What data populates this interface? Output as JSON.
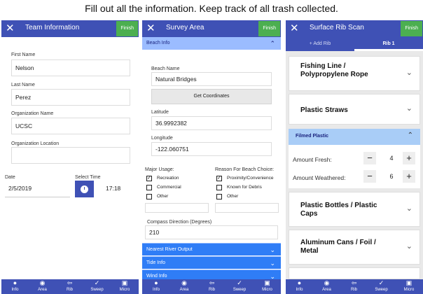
{
  "caption": "Fill out all the information. Keep track of all trash collected.",
  "finish_label": "Finish",
  "close_glyph": "✕",
  "team_info": {
    "title": "Team Information",
    "first_name": {
      "label": "First Name",
      "value": "Nelson"
    },
    "last_name": {
      "label": "Last Name",
      "value": "Perez"
    },
    "org_name": {
      "label": "Organization Name",
      "value": "UCSC"
    },
    "org_location": {
      "label": "Organization Location",
      "value": ""
    },
    "date": {
      "label": "Date",
      "value": "2/5/2019"
    },
    "time": {
      "label": "Select Time",
      "value": "17:18"
    }
  },
  "survey_area": {
    "title": "Survey Area",
    "section": "Beach Info",
    "beach_name": {
      "label": "Beach Name",
      "value": "Natural Bridges"
    },
    "get_coordinates": "Get Coordinates",
    "latitude": {
      "label": "Latitude",
      "value": "36.9992382"
    },
    "longitude": {
      "label": "Longitude",
      "value": "-122.060751"
    },
    "major_usage": {
      "label": "Major Usage:",
      "options": [
        {
          "label": "Recreation",
          "checked": true
        },
        {
          "label": "Commercial",
          "checked": false
        },
        {
          "label": "Other",
          "checked": false
        }
      ]
    },
    "reason": {
      "label": "Reason For Beach Choice:",
      "options": [
        {
          "label": "Proximity/Convenience",
          "checked": true
        },
        {
          "label": "Known for Debris",
          "checked": false
        },
        {
          "label": "Other",
          "checked": false
        }
      ]
    },
    "compass": {
      "label": "Compass Direction (Degrees)",
      "value": "210"
    },
    "collapsed_sections": [
      "Nearest River Output",
      "Tide Info",
      "Wind Info"
    ]
  },
  "rib_scan": {
    "title": "Surface Rib Scan",
    "tabs": [
      "+ Add Rib",
      "Rib 1"
    ],
    "active_tab": "Rib 1",
    "cards": [
      "Fishing Line / Polypropylene Rope",
      "Plastic Straws",
      "Plastic Bottles / Plastic Caps",
      "Aluminum Cans / Foil / Metal"
    ],
    "expanded": {
      "title": "Filmed Plastic",
      "rows": [
        {
          "label": "Amount Fresh:",
          "value": "4"
        },
        {
          "label": "Amount Weathered:",
          "value": "6"
        }
      ]
    }
  },
  "nav": {
    "items": [
      {
        "label": "Info",
        "icon": "person-icon"
      },
      {
        "label": "Area",
        "icon": "globe-icon"
      },
      {
        "label": "Rib",
        "icon": "list-arrow-icon"
      },
      {
        "label": "Sweep",
        "icon": "broom-icon"
      },
      {
        "label": "Micro",
        "icon": "trash-bin-icon"
      }
    ]
  },
  "colors": {
    "primary": "#3f51b5",
    "finish_green": "#4caf50",
    "section_light_blue": "#9bbcff",
    "section_blue": "#2f7df6",
    "expanded_card": "#a9cdf7"
  }
}
